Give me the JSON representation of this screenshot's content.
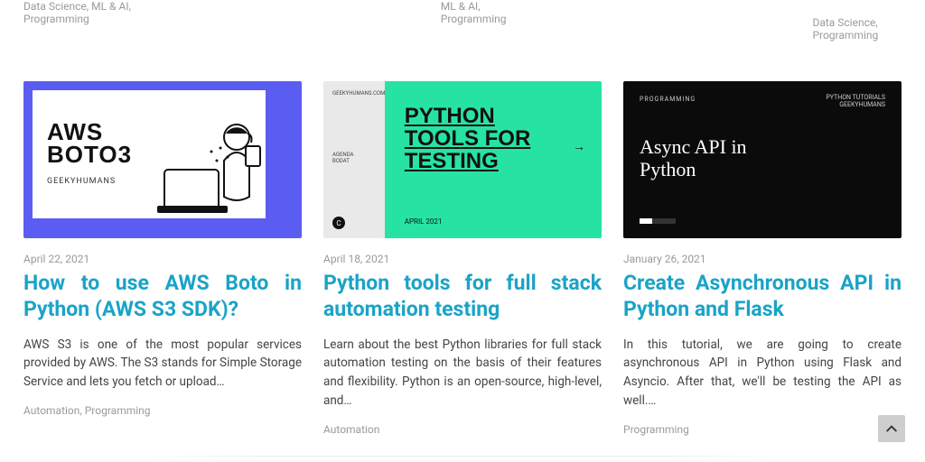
{
  "top_row_tags": {
    "col1": "Data Science, ML & AI, Programming",
    "col2": "ML & AI, Programming",
    "col3": "Data Science, Programming"
  },
  "posts": [
    {
      "thumb": {
        "kind": "aws",
        "heading_line1": "AWS",
        "heading_line2": "BOTO3",
        "brand": "GEEKYHUMANS"
      },
      "date": "April 22, 2021",
      "title": "How to use AWS Boto in Python (AWS S3 SDK)?",
      "excerpt": "AWS S3 is one of the most popular services provided by AWS. The S3 stands for Simple Storage Service and lets you fetch or upload…",
      "tags": "Automation, Programming"
    },
    {
      "thumb": {
        "kind": "pytest",
        "left_tiny": "GEEKYHUMANS.COM",
        "left_tiny2": "AGENDA\\nBODAT",
        "heading": "PYTHON\\nTOOLS FOR\\nTESTING",
        "date": "APRIL 2021"
      },
      "date": "April 18, 2021",
      "title": "Python tools for full stack automation testing",
      "excerpt": "Learn about the best Python libraries for full stack automation testing on the basis of their features and flexibility. Python is an open-source, high-level, and…",
      "tags": "Automation"
    },
    {
      "thumb": {
        "kind": "async",
        "tag": "PROGRAMMING",
        "brand": "PYTHON TUTORIALS\\nGEEKYHUMANS",
        "title": "Async API in\\nPython"
      },
      "date": "January 26, 2021",
      "title": "Create Asynchronous API in Python and Flask",
      "excerpt": "In this tutorial, we are going to create asynchronous API in Python using Flask and Asyncio. After that, we'll be testing the API as well.…",
      "tags": "Programming"
    }
  ],
  "icons": {
    "scroll_top": "chevron-up"
  },
  "colors": {
    "link": "#1aa3c7",
    "thumb1_bg": "#5b5cf1",
    "thumb2_bg": "#26e3a4",
    "thumb3_bg": "#0b0b0b"
  }
}
